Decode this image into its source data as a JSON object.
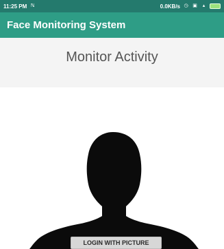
{
  "status_bar": {
    "time": "11:25 PM",
    "network_speed": "0.0KB/s",
    "icons": [
      "notification-icon",
      "alarm-icon",
      "volte-icon",
      "signal-icon",
      "battery-icon"
    ]
  },
  "app_bar": {
    "title": "Face Monitoring System"
  },
  "main": {
    "title": "Monitor Activity",
    "login_button_label": "LOGIN WITH PICTURE"
  },
  "colors": {
    "status_bar": "#247a6d",
    "app_bar": "#2e9d86",
    "silhouette": "#0b0b0b"
  }
}
